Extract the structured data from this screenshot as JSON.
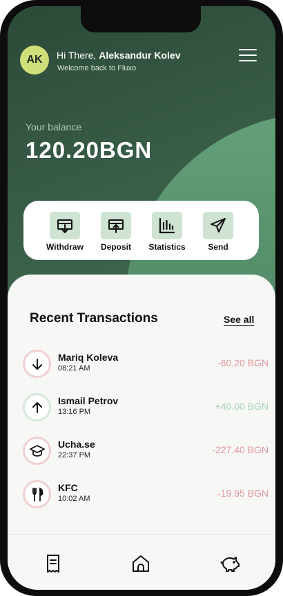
{
  "header": {
    "avatar_initials": "AK",
    "greeting_prefix": "Hi There, ",
    "user_name": "Aleksandur Kolev",
    "welcome": "Welcome back to Fluxo"
  },
  "balance": {
    "label": "Your balance",
    "amount": "120.20BGN"
  },
  "actions": [
    {
      "label": "Withdraw",
      "icon": "withdraw-icon"
    },
    {
      "label": "Deposit",
      "icon": "deposit-icon"
    },
    {
      "label": "Statistics",
      "icon": "statistics-icon"
    },
    {
      "label": "Send",
      "icon": "send-icon"
    }
  ],
  "transactions": {
    "title": "Recent Transactions",
    "see_all": "See all",
    "items": [
      {
        "name": "Mariq Koleva",
        "time": "08:21 AM",
        "amount": "-60.20 BGN",
        "icon": "arrow-down-icon",
        "type": "debit"
      },
      {
        "name": "Ismail Petrov",
        "time": "13:16 PM",
        "amount": "+40.00 BGN",
        "icon": "arrow-up-icon",
        "type": "credit"
      },
      {
        "name": "Ucha.se",
        "time": "22:37 PM",
        "amount": "-227.40 BGN",
        "icon": "graduation-cap-icon",
        "type": "debit"
      },
      {
        "name": "KFC",
        "time": "10:02 AM",
        "amount": "-19.95 BGN",
        "icon": "fork-knife-icon",
        "type": "debit"
      }
    ]
  },
  "bottom_nav": [
    {
      "icon": "receipt-icon"
    },
    {
      "icon": "home-icon"
    },
    {
      "icon": "piggy-bank-icon"
    }
  ],
  "colors": {
    "hero_dark": "#2b4a38",
    "accent_green": "#63a07a",
    "avatar_bg": "#cfe07a",
    "action_icon_bg": "#cfe3d3",
    "debit": "#e09a9a",
    "credit": "#a6d4b4",
    "debit_ring": "#efcfcf",
    "credit_ring": "#d6e9db"
  }
}
